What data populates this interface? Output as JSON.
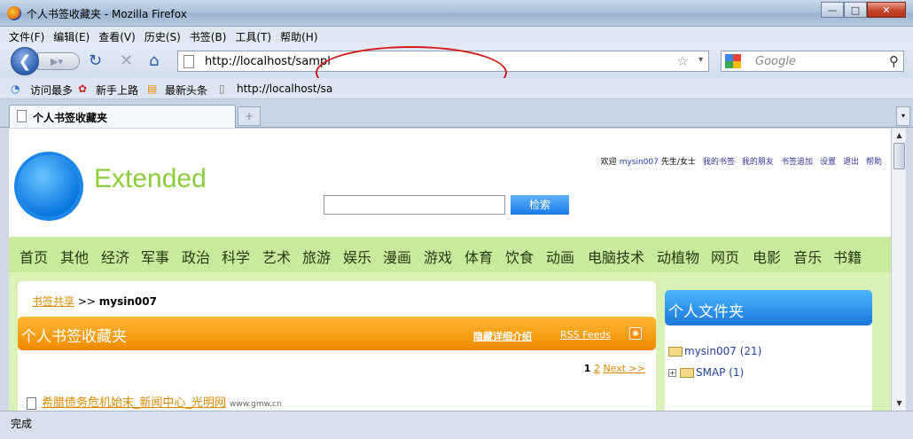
{
  "window": {
    "title": "个人书签收藏夹 - Mozilla Firefox",
    "minimize": "—",
    "maximize": "□",
    "close": "✕"
  },
  "menu": [
    "文件(F)",
    "编辑(E)",
    "查看(V)",
    "历史(S)",
    "书签(B)",
    "工具(T)",
    "帮助(H)"
  ],
  "nav": {
    "url": "http://localhost/sampl",
    "search_placeholder": "Google"
  },
  "bookmarks_bar": [
    "访问最多",
    "新手上路",
    "最新头条",
    "http://localhost/sa"
  ],
  "tab": {
    "title": "个人书签收藏夹",
    "new_tab": "+"
  },
  "page": {
    "logo": "Extended",
    "userlinks": {
      "welcome": "欢迎",
      "user": "mysin007",
      "honorific": "先生/女士",
      "links": [
        "我的书签",
        "我的朋友",
        "书签追加",
        "设置",
        "退出",
        "帮助"
      ]
    },
    "search_button": "检索",
    "categories": [
      "首页",
      "其他",
      "经济",
      "军事",
      "政治",
      "科学",
      "艺术",
      "旅游",
      "娱乐",
      "漫画",
      "游戏",
      "体育",
      "饮食",
      "动画",
      "电脑技术",
      "动植物",
      "网页",
      "电影",
      "音乐",
      "书籍"
    ],
    "breadcrumb": {
      "link": "书签共享",
      "sep": ">>",
      "user": "mysin007"
    },
    "section_title": "个人书签收藏夹",
    "hide_details": "隐藏详细介绍",
    "rss": "RSS Feeds",
    "pager": {
      "current": "1",
      "next_page": "2",
      "next": "Next >>"
    },
    "item": {
      "title": "希腊债务危机始末_新闻中心_光明网",
      "domain": "www.gmw.cn"
    },
    "sidebar": {
      "title": "个人文件夹",
      "folders": [
        {
          "label": "mysin007 (21)"
        },
        {
          "label": "SMAP (1)",
          "expander": "+"
        }
      ]
    }
  },
  "status": "完成"
}
